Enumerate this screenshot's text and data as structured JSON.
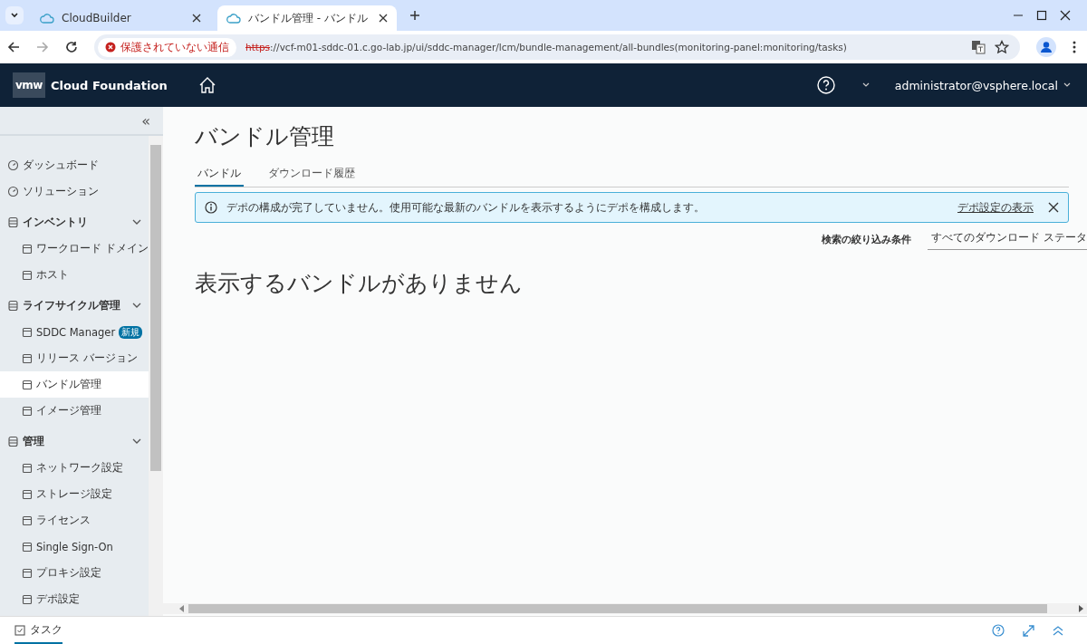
{
  "browser": {
    "tabs": [
      {
        "title": "CloudBuilder",
        "selected": false
      },
      {
        "title": "バンドル管理 - バンドル",
        "selected": true
      }
    ],
    "security_label": "保護されていない通信",
    "url_scheme": "https",
    "url_rest": "://vcf-m01-sddc-01.c.go-lab.jp/ui/sddc-manager/lcm/bundle-management/all-bundles(monitoring-panel:monitoring/tasks)"
  },
  "header": {
    "logo": "vmw",
    "product": "Cloud Foundation",
    "user": "administrator@vsphere.local"
  },
  "sidebar": {
    "collapse_glyph": "«",
    "items": [
      {
        "label": "ダッシュボード",
        "selected": false
      },
      {
        "label": "ソリューション",
        "selected": false
      },
      {
        "label": "インベントリ",
        "expanded": true,
        "children": [
          {
            "label": "ワークロード ドメイン",
            "selected": false
          },
          {
            "label": "ホスト",
            "selected": false
          }
        ]
      },
      {
        "label": "ライフサイクル管理",
        "expanded": true,
        "children": [
          {
            "label": "SDDC Manager",
            "badge": "新規",
            "selected": false
          },
          {
            "label": "リリース バージョン",
            "selected": false
          },
          {
            "label": "バンドル管理",
            "selected": true
          },
          {
            "label": "イメージ管理",
            "selected": false
          }
        ]
      },
      {
        "label": "管理",
        "expanded": true,
        "children": [
          {
            "label": "ネットワーク設定",
            "selected": false
          },
          {
            "label": "ストレージ設定",
            "selected": false
          },
          {
            "label": "ライセンス",
            "selected": false
          },
          {
            "label": "Single Sign-On",
            "selected": false
          },
          {
            "label": "プロキシ設定",
            "selected": false
          },
          {
            "label": "デポ設定",
            "selected": false
          }
        ]
      }
    ]
  },
  "page": {
    "title": "バンドル管理",
    "tabs": [
      {
        "label": "バンドル",
        "selected": true
      },
      {
        "label": "ダウンロード履歴",
        "selected": false
      }
    ],
    "alert": {
      "message": "デポの構成が完了していません。使用可能な最新のバンドルを表示するようにデポを構成します。",
      "link": "デポ設定の表示"
    },
    "filter_label": "検索の絞り込み条件",
    "filter_value": "すべてのダウンロード ステータ",
    "empty_message": "表示するバンドルがありません"
  },
  "footer": {
    "tasks_label": "タスク"
  }
}
